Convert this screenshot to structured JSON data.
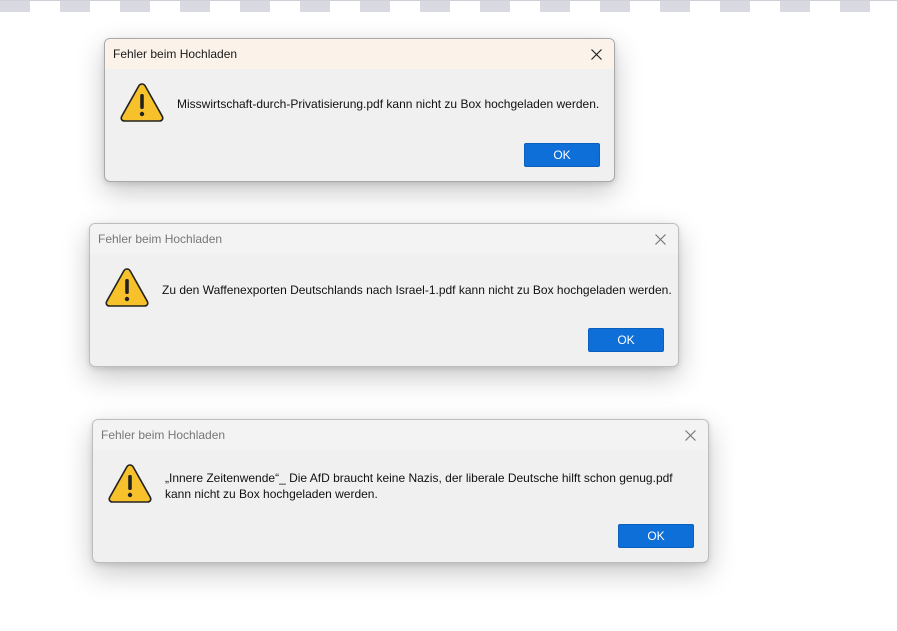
{
  "dialogs": [
    {
      "title": "Fehler beim Hochladen",
      "message_lines": [
        "Misswirtschaft-durch-Privatisierung.pdf kann nicht zu Box hochgeladen werden."
      ],
      "ok_label": "OK",
      "active": true
    },
    {
      "title": "Fehler beim Hochladen",
      "message_lines": [
        "Zu den Waffenexporten Deutschlands nach Israel-1.pdf kann nicht zu Box hochgeladen werden."
      ],
      "ok_label": "OK",
      "active": false
    },
    {
      "title": "Fehler beim Hochladen",
      "message_lines": [
        "„Innere Zeitenwende“_ Die AfD braucht keine Nazis, der liberale Deutsche hilft schon genug.pdf",
        "kann nicht zu Box hochgeladen werden."
      ],
      "ok_label": "OK",
      "active": false
    }
  ],
  "icons": {
    "warning": "warning-icon",
    "close": "close-icon"
  },
  "colors": {
    "ok_button": "#0f6fd8",
    "warning_fill": "#f7c12b",
    "dialog_bg": "#f0f0f0",
    "active_titlebar": "#fbf3ea"
  }
}
